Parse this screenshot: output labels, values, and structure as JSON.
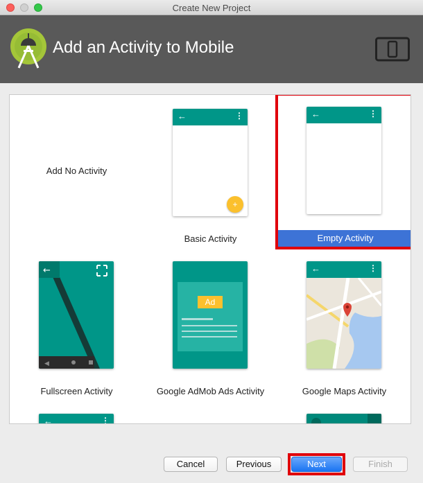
{
  "window": {
    "title": "Create New Project"
  },
  "header": {
    "title": "Add an Activity to Mobile",
    "logo_icon": "android-studio-icon",
    "device_icon": "phone-tablet-icon"
  },
  "gallery": {
    "items": [
      {
        "label": "Add No Activity"
      },
      {
        "label": "Basic Activity"
      },
      {
        "label": "Empty Activity",
        "selected": true
      },
      {
        "label": "Fullscreen Activity"
      },
      {
        "label": "Google AdMob Ads Activity",
        "ad_badge": "Ad"
      },
      {
        "label": "Google Maps Activity"
      }
    ]
  },
  "footer": {
    "cancel": "Cancel",
    "previous": "Previous",
    "next": "Next",
    "finish": "Finish"
  },
  "colors": {
    "teal": "#009688",
    "selection_blue": "#3d73d6",
    "highlight_red": "#e0000b",
    "header_bg": "#595959"
  }
}
